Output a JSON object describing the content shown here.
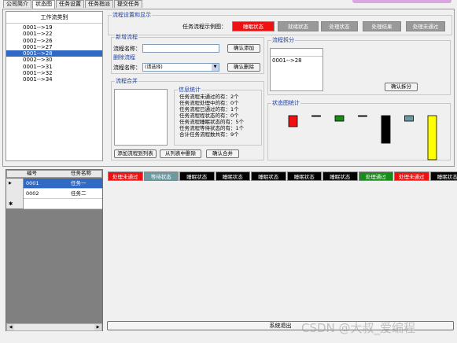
{
  "tabs": [
    "公司简介",
    "状态图",
    "任务设置",
    "任务指派",
    "提交任务"
  ],
  "active_tab": 1,
  "listbox": {
    "header": "工作流类别",
    "items": [
      "0001-->19",
      "0001-->22",
      "0002-->26",
      "0001-->27",
      "0001-->28",
      "0002-->30",
      "0001-->31",
      "0001-->32",
      "0001-->34"
    ],
    "selected_index": 4
  },
  "display_group": {
    "title": "流程设置和显示",
    "example_label": "任务流程示例图：",
    "states": [
      {
        "label": "睡眠状态",
        "color": "#ee1111",
        "text_color": "#ffffff"
      },
      {
        "label": "就绪状态",
        "color": "#999999",
        "text_color": "#ffffff"
      },
      {
        "label": "处理状态",
        "color": "#999999",
        "text_color": "#ffffff"
      },
      {
        "label": "处理结果",
        "color": "#999999",
        "text_color": "#ffffff"
      },
      {
        "label": "处理未通过",
        "color": "#999999",
        "text_color": "#ffffff"
      }
    ]
  },
  "add_group": {
    "title": "新增流程",
    "name_label": "流程名称：",
    "name_value": "",
    "confirm_add": "确认添加"
  },
  "delete_group": {
    "title": "删除流程",
    "name_label": "流程名称：",
    "select_value": "(请选择)",
    "confirm_delete": "确认删除"
  },
  "split_group": {
    "title": "流程拆分",
    "list_items": [
      "0001-->28"
    ],
    "confirm_split": "确认拆分"
  },
  "merge_group": {
    "title": "流程合并",
    "info_title": "信息统计",
    "stats": [
      "任务流程未通过的有：2个",
      "任务流程处理中的有：0个",
      "任务流程已通过的有：1个",
      "任务流程程状态的有：0个",
      "任务流程睡眠状态的有：5个",
      "任务流程等待状态的有：1个",
      "合计任务流程数共有：9个"
    ],
    "add_to_list": "添加流程到列表",
    "remove_from_list": "从列表中删除",
    "confirm_merge": "确认合并"
  },
  "stats_group": {
    "title": "状态图统计",
    "bars": [
      {
        "color": "#ee1111",
        "value": 1,
        "border": "#000000"
      },
      {
        "color": "#000000",
        "value": 0,
        "border": "#000000"
      },
      {
        "color": "#1a8a1a",
        "value": 0.5,
        "border": "#000000"
      },
      {
        "color": "#000000",
        "value": 0,
        "border": "#000000"
      },
      {
        "color": "#000000",
        "value": 2.5,
        "border": "#000000"
      },
      {
        "color": "#6a9aa0",
        "value": 0.5,
        "border": "#000000"
      },
      {
        "color": "#ffff00",
        "value": 4,
        "border": "#000000"
      }
    ]
  },
  "task_grid": {
    "columns": [
      "编号",
      "任务名称"
    ],
    "rows": [
      {
        "id": "0001",
        "name": "任务一",
        "selected": true
      },
      {
        "id": "0002",
        "name": "任务二",
        "selected": false
      }
    ]
  },
  "status_strip": [
    {
      "label": "处理未通过",
      "color": "#ee1111"
    },
    {
      "label": "等待状态",
      "color": "#6a9aa0"
    },
    {
      "label": "睡眠状态",
      "color": "#000000"
    },
    {
      "label": "睡眠状态",
      "color": "#000000"
    },
    {
      "label": "睡眠状态",
      "color": "#000000"
    },
    {
      "label": "睡眠状态",
      "color": "#000000"
    },
    {
      "label": "睡眠状态",
      "color": "#000000"
    },
    {
      "label": "处理通过",
      "color": "#1a8a1a"
    },
    {
      "label": "处理未通过",
      "color": "#ee1111"
    },
    {
      "label": "睡眠状态",
      "color": "#000000"
    }
  ],
  "exit_button": "系统退出",
  "watermark": "CSDN @大叔_爱编程"
}
